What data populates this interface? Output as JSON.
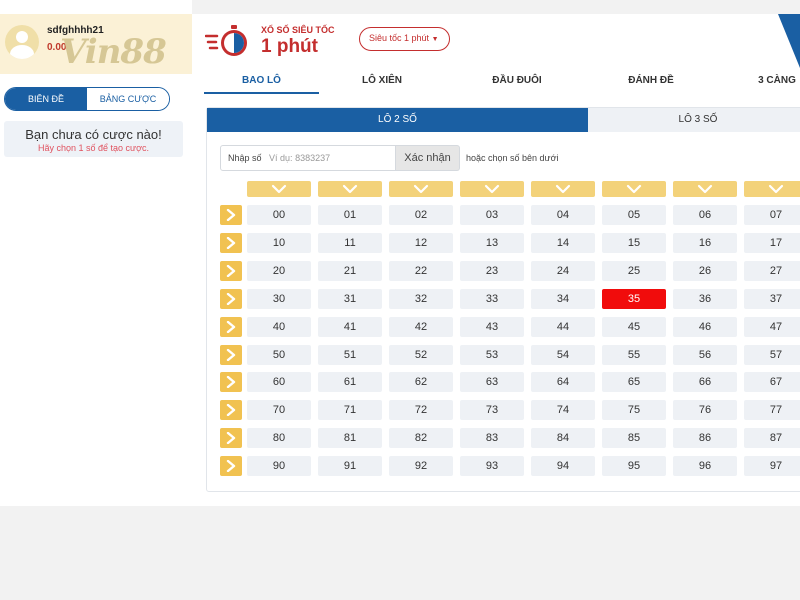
{
  "user": {
    "name": "sdfghhhh21",
    "balance": "0.00",
    "logo_text": "Vin88"
  },
  "sidebar": {
    "tabs": [
      {
        "label": "BIÊN ĐỀ",
        "active": true
      },
      {
        "label": "BẢNG CƯỢC",
        "active": false
      }
    ],
    "empty_title": "Bạn chưa có cược nào!",
    "empty_hint": "Hãy chọn 1 số để tạo cược."
  },
  "game": {
    "subtitle": "XỔ SỐ SIÊU TỐC",
    "title": "1 phút",
    "speed_select": "Siêu tốc 1 phút"
  },
  "nav_tabs": [
    {
      "label": "BAO LÔ",
      "active": true
    },
    {
      "label": "LÔ XIÊN",
      "active": false
    },
    {
      "label": "ĐẦU ĐUÔI",
      "active": false
    },
    {
      "label": "ĐÁNH ĐỀ",
      "active": false
    },
    {
      "label": "3 CÀNG",
      "active": false
    }
  ],
  "sub_tabs": [
    {
      "label": "LÔ 2 SỐ",
      "active": true
    },
    {
      "label": "LÔ 3 SỐ",
      "active": false
    }
  ],
  "input": {
    "label": "Nhập số",
    "placeholder": "Ví dụ: 8383237",
    "confirm": "Xác nhận",
    "hint": "hoặc chọn số bên dưới"
  },
  "number_grid": {
    "rows": [
      [
        "00",
        "01",
        "02",
        "03",
        "04",
        "05",
        "06",
        "07"
      ],
      [
        "10",
        "11",
        "12",
        "13",
        "14",
        "15",
        "16",
        "17"
      ],
      [
        "20",
        "21",
        "22",
        "23",
        "24",
        "25",
        "26",
        "27"
      ],
      [
        "30",
        "31",
        "32",
        "33",
        "34",
        "35",
        "36",
        "37"
      ],
      [
        "40",
        "41",
        "42",
        "43",
        "44",
        "45",
        "46",
        "47"
      ],
      [
        "50",
        "51",
        "52",
        "53",
        "54",
        "55",
        "56",
        "57"
      ],
      [
        "60",
        "61",
        "62",
        "63",
        "64",
        "65",
        "66",
        "67"
      ],
      [
        "70",
        "71",
        "72",
        "73",
        "74",
        "75",
        "76",
        "77"
      ],
      [
        "80",
        "81",
        "82",
        "83",
        "84",
        "85",
        "86",
        "87"
      ],
      [
        "90",
        "91",
        "92",
        "93",
        "94",
        "95",
        "96",
        "97"
      ]
    ],
    "selected": [
      "35"
    ]
  },
  "icons": {
    "column_toggle": "chevron-down-icon",
    "row_toggle": "chevron-right-icon",
    "clock": "stopwatch-icon",
    "avatar": "user-avatar-icon"
  },
  "colors": {
    "primary": "#1a5fa3",
    "accent": "#c42e2e",
    "selected": "#f10c0c",
    "chip": "#f3d27a"
  }
}
